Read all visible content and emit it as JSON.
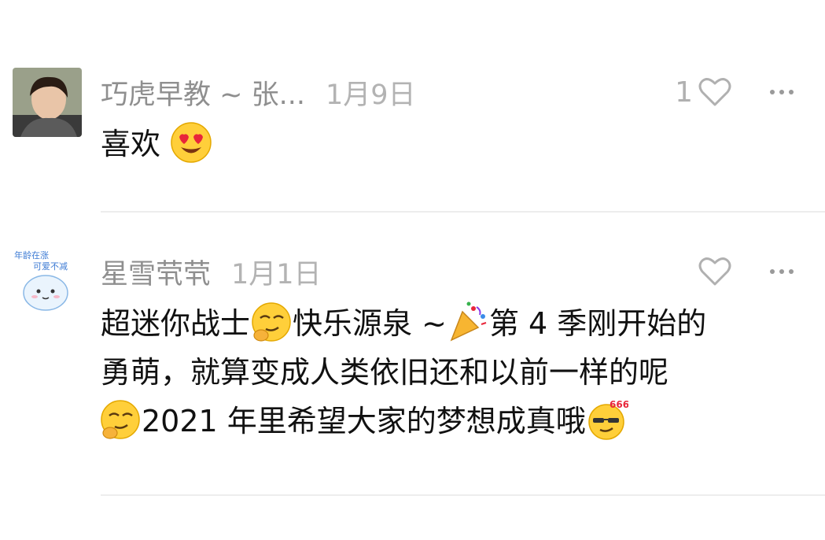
{
  "comments": [
    {
      "author": "巧虎早教 ~ 张...",
      "date": "1月9日",
      "like_count": "1",
      "text": "喜欢"
    },
    {
      "author": "星雪茕茕",
      "date": "1月1日",
      "like_count": "",
      "segments": [
        "超迷你战士",
        "快乐源泉 ~",
        "第 4 季刚开始的",
        "勇萌，就算变成人类依旧还和以前一样的呢",
        "2021 年里希望大家的梦想成真哦"
      ],
      "avatar_texts": [
        "年龄在涨",
        "可爱不减"
      ]
    }
  ],
  "emojis": [
    "heart-eyes-emoji",
    "smirk-emoji",
    "party-popper-emoji",
    "cool-666-emoji"
  ]
}
